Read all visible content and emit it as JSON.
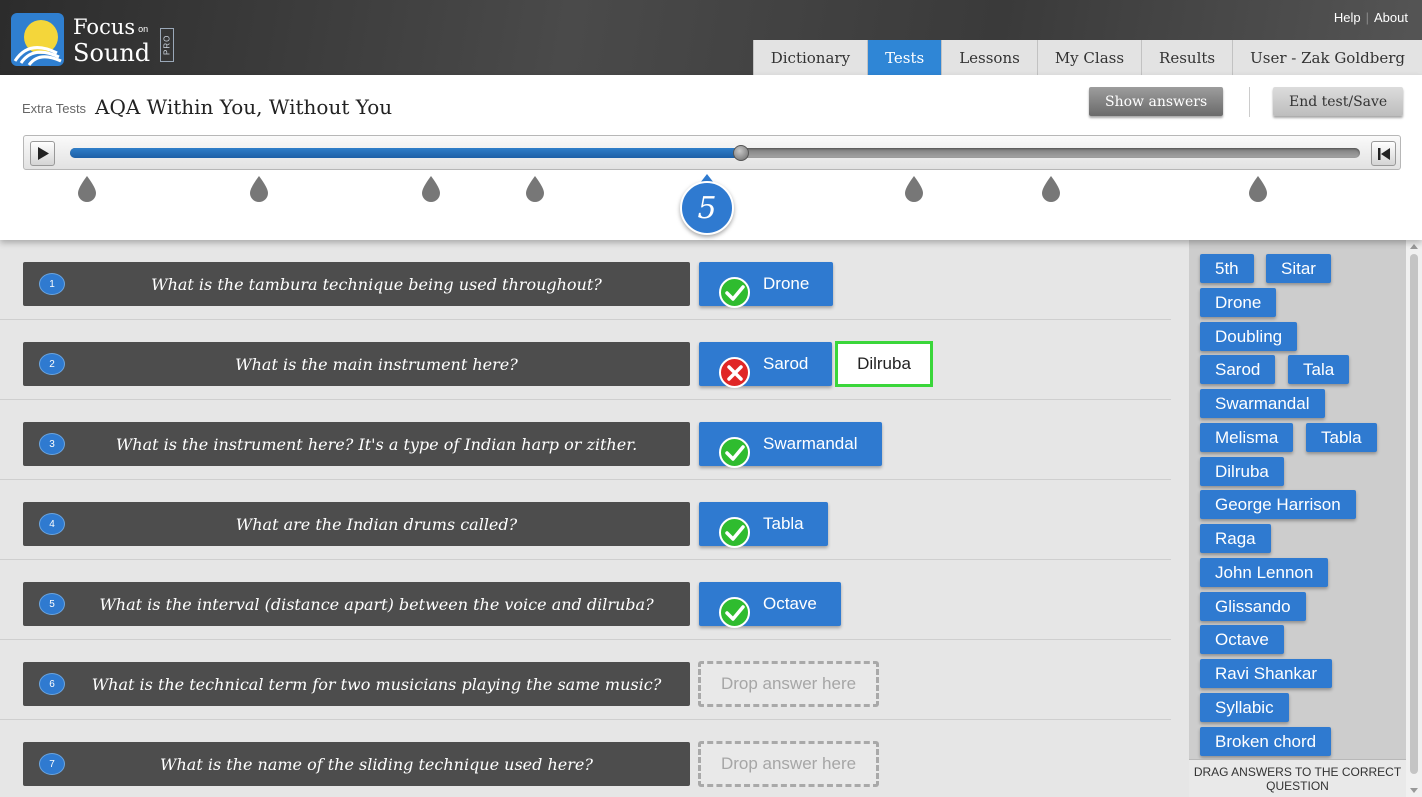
{
  "app": {
    "logo_line1": "Focus",
    "logo_on": "on",
    "logo_line2": "Sound",
    "logo_pro": "PRO"
  },
  "toplinks": {
    "help": "Help",
    "about": "About"
  },
  "nav": {
    "tabs": [
      "Dictionary",
      "Tests",
      "Lessons",
      "My Class",
      "Results",
      "User - Zak Goldberg"
    ],
    "active": "Tests"
  },
  "test": {
    "crumb": "Extra Tests",
    "title": "AQA Within You, Without You",
    "show_answers": "Show answers",
    "end_test": "End test/Save"
  },
  "player": {
    "progress_percent": 52,
    "current_question": "5",
    "markers_count": 8
  },
  "questions": [
    {
      "num": "1",
      "text": "What is the tambura technique being used throughout?",
      "answer": "Drone",
      "result": "correct"
    },
    {
      "num": "2",
      "text": "What is the main instrument here?",
      "answer": "Sarod",
      "result": "incorrect",
      "correct_answer": "Dilruba"
    },
    {
      "num": "3",
      "text": "What is the instrument here? It's a type of Indian harp or zither.",
      "answer": "Swarmandal",
      "result": "correct"
    },
    {
      "num": "4",
      "text": "What are the Indian drums called?",
      "answer": "Tabla",
      "result": "correct"
    },
    {
      "num": "5",
      "text": "What is the interval (distance apart) between the voice and dilruba?",
      "answer": "Octave",
      "result": "correct"
    },
    {
      "num": "6",
      "text": "What is the technical term for two musicians playing the same music?",
      "placeholder": "Drop answer here"
    },
    {
      "num": "7",
      "text": "What is the name of the sliding technique used here?",
      "placeholder": "Drop answer here"
    }
  ],
  "bank": {
    "chips": [
      "5th",
      "Sitar",
      "Drone",
      "Doubling",
      "Sarod",
      "Tala",
      "Swarmandal",
      "Melisma",
      "Tabla",
      "Dilruba",
      "George Harrison",
      "Raga",
      "John Lennon",
      "Glissando",
      "Octave",
      "Ravi Shankar",
      "Syllabic",
      "Broken chord"
    ],
    "hint": "DRAG ANSWERS TO THE CORRECT QUESTION"
  },
  "colors": {
    "accent": "#2f7ad0",
    "correct": "#2fbc2f",
    "incorrect": "#e02626",
    "correct_outline": "#3ad63a"
  }
}
